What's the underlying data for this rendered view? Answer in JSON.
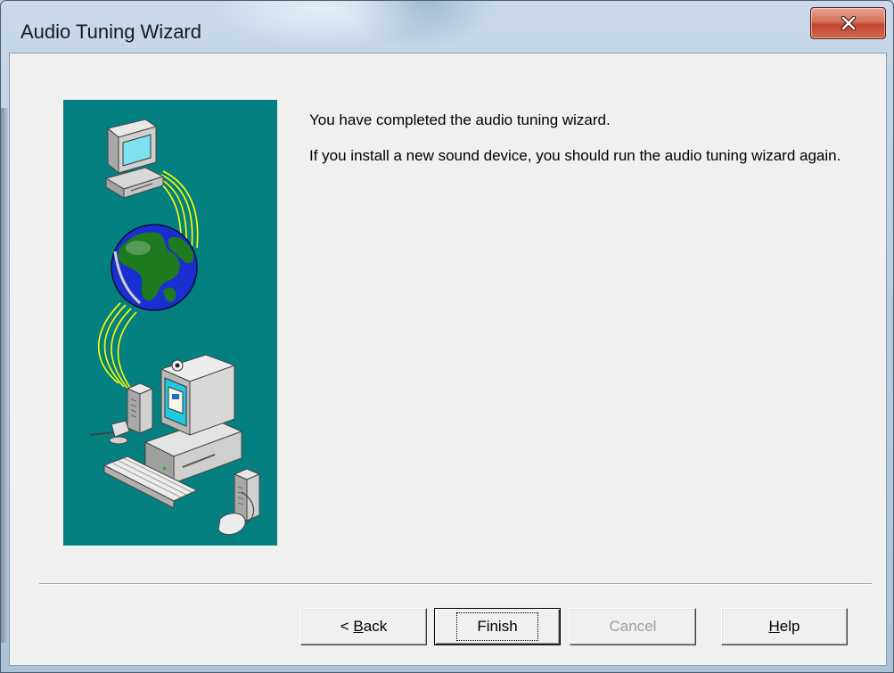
{
  "window": {
    "title": "Audio Tuning Wizard"
  },
  "titlebar": {
    "close_icon": "close-x-icon"
  },
  "content": {
    "line1": "You have completed the audio tuning wizard.",
    "line2": "If you install a new sound device, you should run the audio tuning wizard again."
  },
  "illustration": {
    "description_icon": "network-computers-globe-illustration",
    "background_color": "#048080"
  },
  "buttons": {
    "back": {
      "prefix": "< ",
      "accel": "B",
      "rest": "ack",
      "enabled": true
    },
    "finish": {
      "label": "Finish",
      "default": true,
      "enabled": true
    },
    "cancel": {
      "label": "Cancel",
      "enabled": false
    },
    "help": {
      "accel": "H",
      "rest": "elp",
      "enabled": true
    }
  },
  "colors": {
    "dialog_bg": "#f0f0f0",
    "close_button": "#c24632",
    "illustration_bg": "#048080"
  }
}
